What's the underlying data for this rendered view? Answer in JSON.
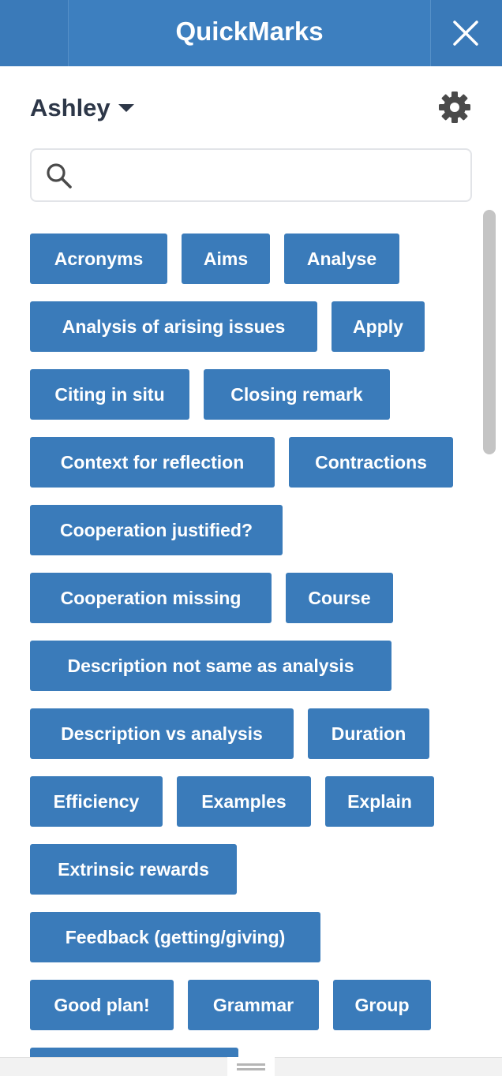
{
  "header": {
    "title": "QuickMarks",
    "close_icon": "close-icon"
  },
  "user": {
    "name": "Ashley",
    "dropdown_icon": "caret-down-icon"
  },
  "settings": {
    "icon": "gear-icon"
  },
  "search": {
    "placeholder": "",
    "value": "",
    "icon": "search-icon"
  },
  "colors": {
    "brand": "#3a7ab9",
    "tag": "#3a7bba",
    "text_dark": "#2d3748"
  },
  "tags": [
    "Acronyms",
    "Aims",
    "Analyse",
    "Analysis of arising issues",
    "Apply",
    "Citing in situ",
    "Closing remark",
    "Context for reflection",
    "Contractions",
    "Cooperation justified?",
    "Cooperation missing",
    "Course",
    "Description not same as analysis",
    "Description vs analysis",
    "Duration",
    "Efficiency",
    "Examples",
    "Explain",
    "Extrinsic rewards",
    "Feedback (getting/giving)",
    "Good plan!",
    "Grammar",
    "Group",
    ""
  ]
}
